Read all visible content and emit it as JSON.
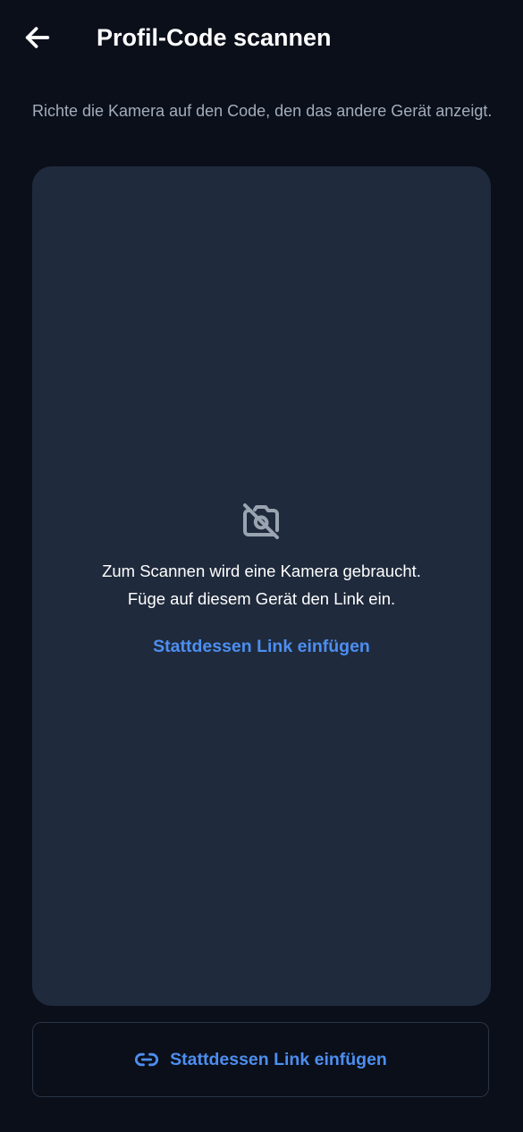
{
  "header": {
    "title": "Profil-Code scannen",
    "back_icon": "arrow-left-icon"
  },
  "instructions": "Richte die Kamera auf den Code, den das andere Gerät anzeigt.",
  "camera_panel": {
    "icon": "camera-off-icon",
    "message_line1": "Zum Scannen wird eine Kamera gebraucht.",
    "message_line2": "Füge auf diesem Gerät den Link ein.",
    "link_label": "Stattdessen Link einfügen"
  },
  "paste_button": {
    "icon": "link-icon",
    "label": "Stattdessen Link einfügen"
  },
  "colors": {
    "background": "#0a0f1a",
    "panel": "#1f2a3c",
    "accent": "#4d8ef0",
    "muted_text": "#a4adbb",
    "border": "#2a3444"
  }
}
